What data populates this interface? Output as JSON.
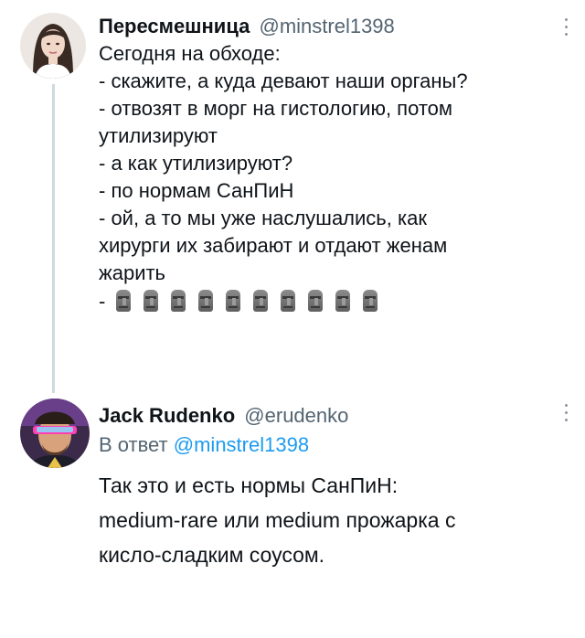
{
  "tweets": [
    {
      "display_name": "Пересмешница",
      "handle": "@minstrel1398",
      "avatar_icon": "user-avatar-woman",
      "lines": [
        "Сегодня на обходе:",
        "- скажите, а куда девают наши органы?",
        "- отвозят в морг на гистологию, потом",
        "утилизируют",
        "- а как утилизируют?",
        "- по нормам СанПиН",
        "- ой, а то мы уже наслушались, как",
        "хирурги их забирают и отдают женам",
        "жарить"
      ],
      "emoji_line": {
        "prefix": "-",
        "emoji": "moai-emoji",
        "count": 10
      }
    },
    {
      "display_name": "Jack Rudenko",
      "handle": "@erudenko",
      "avatar_icon": "user-avatar-man",
      "reply_prefix": "В ответ",
      "reply_handle": "@minstrel1398",
      "lines": [
        "Так это и есть нормы СанПиН:",
        "medium-rare или medium прожарка с",
        "кисло-сладким соусом."
      ]
    }
  ],
  "colors": {
    "text": "#0f1419",
    "secondary": "#536471",
    "link": "#1d9bf0",
    "thread_line": "#cfd9de"
  }
}
